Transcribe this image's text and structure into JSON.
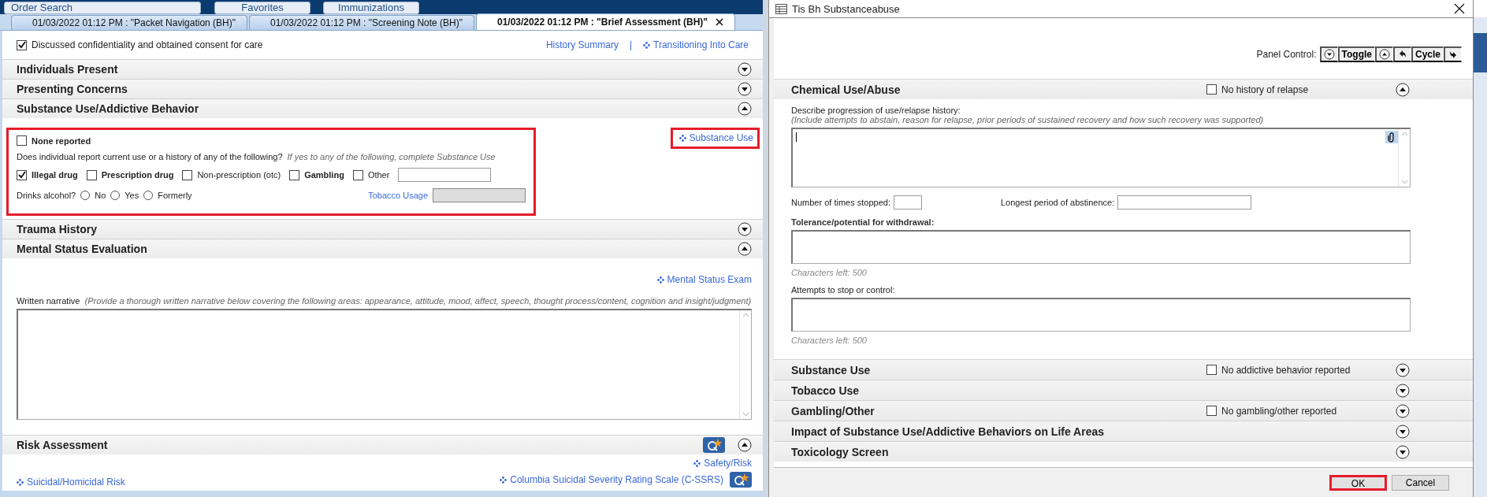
{
  "top_bar": {
    "buttons": [
      "Order Search",
      "Favorites",
      "Immunizations"
    ]
  },
  "tabs": [
    {
      "label": "01/03/2022 01:12 PM : \"Packet Navigation (BH)\"",
      "selected": false
    },
    {
      "label": "01/03/2022 01:12 PM : \"Screening Note (BH)\"",
      "selected": false
    },
    {
      "label": "01/03/2022 01:12 PM : \"Brief Assessment (BH)\"",
      "selected": true
    }
  ],
  "consent": {
    "label": "Discussed confidentiality and obtained consent for care",
    "checked": true
  },
  "header_links": [
    {
      "kind": "plain",
      "text": "History Summary"
    },
    {
      "kind": "separator",
      "text": "|"
    },
    {
      "kind": "form",
      "text": "Transitioning Into Care"
    }
  ],
  "sections": [
    {
      "kind": "plain",
      "title": "Individuals Present",
      "expanded": false
    },
    {
      "kind": "plain",
      "title": "Presenting Concerns",
      "expanded": false
    },
    {
      "kind": "substance",
      "title": "Substance Use/Addictive Behavior",
      "expanded": true,
      "highlighted": true,
      "none_reported": {
        "label": "None reported",
        "checked": false
      },
      "question": "Does individual report current use or a history of any of the following?",
      "hint": "If yes to any of the following, complete Substance Use",
      "options": [
        {
          "label": "Illegal drug",
          "checked": true,
          "bold": true
        },
        {
          "label": "Prescription drug",
          "checked": false,
          "bold": true
        },
        {
          "label": "Non-prescription (otc)",
          "checked": false,
          "bold": false
        },
        {
          "label": "Gambling",
          "checked": false,
          "bold": true
        },
        {
          "label": "Other",
          "checked": false,
          "bold": false,
          "field": true
        }
      ],
      "alcohol": {
        "label": "Drinks alcohol?",
        "choices": [
          {
            "label": "No",
            "selected": false
          },
          {
            "label": "Yes",
            "selected": false
          },
          {
            "label": "Formerly",
            "selected": false
          }
        ]
      },
      "tobacco": {
        "label": "Tobacco Usage",
        "disabled": true
      },
      "link": {
        "text": "Substance Use",
        "highlighted": true
      }
    },
    {
      "kind": "plain",
      "title": "Trauma History",
      "expanded": false
    },
    {
      "kind": "mental",
      "title": "Mental Status Evaluation",
      "expanded": true,
      "link": "Mental Status Exam",
      "label": "Written narrative",
      "hint": "(Provide a thorough written narrative below covering the following areas: appearance, attitude, mood, affect, speech, thought process/content, cognition and insight/judgment)"
    },
    {
      "kind": "risk",
      "title": "Risk Assessment",
      "expanded": true,
      "links": [
        "Safety/Risk",
        "Suicidal/Homicidal Risk",
        "Columbia Suicidal Severity Rating Scale (C-SSRS)"
      ]
    }
  ],
  "dialog": {
    "title": "Tis Bh Substanceabuse",
    "panel_control": {
      "label": "Panel Control:",
      "buttons": [
        {
          "kind": "expand"
        },
        {
          "kind": "text",
          "text": "Toggle"
        },
        {
          "kind": "collapse"
        },
        {
          "kind": "back"
        },
        {
          "kind": "text",
          "text": "Cycle"
        },
        {
          "kind": "forward"
        }
      ]
    },
    "sections": [
      {
        "title": "Chemical Use/Abuse",
        "expanded": true,
        "checkbox": {
          "label": "No history of relapse",
          "checked": false
        },
        "content": {
          "progression_label": "Describe progression of use/relapse history:",
          "progression_hint": "(Include attempts to abstain, reason for relapse, prior periods of sustained recovery and how such recovery was supported)",
          "times_label": "Number of times stopped:",
          "longest_label": "Longest period of abstinence:",
          "tolerance_label": "Tolerance/potential for withdrawal:",
          "tolerance_left": "Characters left:  500",
          "attempts_label": "Attempts to stop or control:",
          "attempts_left": "Characters left:  500"
        }
      },
      {
        "title": "Substance Use",
        "expanded": false,
        "checkbox": {
          "label": "No addictive behavior reported",
          "checked": false
        }
      },
      {
        "title": "Tobacco Use",
        "expanded": false
      },
      {
        "title": "Gambling/Other",
        "expanded": false,
        "checkbox": {
          "label": "No gambling/other reported",
          "checked": false
        }
      },
      {
        "title": "Impact of Substance Use/Addictive Behaviors on Life Areas",
        "expanded": false
      },
      {
        "title": "Toxicology Screen",
        "expanded": false
      }
    ],
    "buttons": [
      {
        "label": "OK",
        "highlighted": true
      },
      {
        "label": "Cancel",
        "highlighted": false
      }
    ]
  }
}
